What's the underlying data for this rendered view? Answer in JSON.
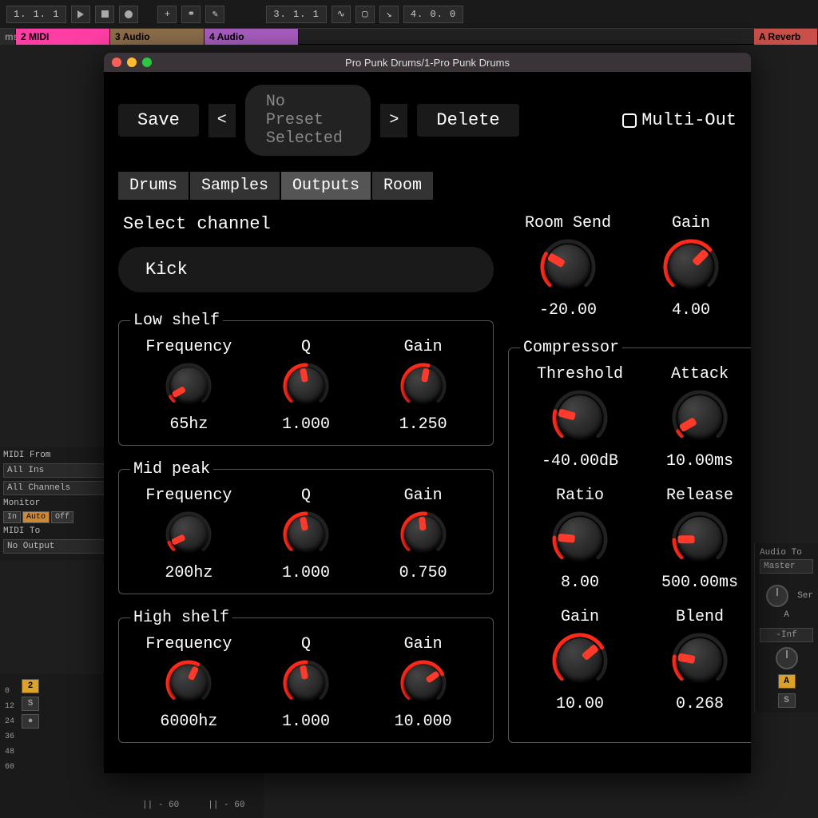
{
  "transport": {
    "pos1": "1. 1. 1",
    "pos2": "3. 1. 1",
    "pos3": "4. 0. 0"
  },
  "tracks": {
    "left": "ms",
    "midi": "2 MIDI",
    "audio1": "3 Audio",
    "audio2": "4 Audio",
    "reverb": "A Reverb"
  },
  "leftpanel": {
    "midi_from": "MIDI From",
    "all_ins": "All Ins",
    "all_channels": "All Channels",
    "monitor": "Monitor",
    "in": "In",
    "auto": "Auto",
    "off": "Off",
    "midi_to": "MIDI To",
    "no_output": "No Output"
  },
  "rightpanel": {
    "audio_to": "Audio To",
    "master": "Master",
    "sends_label": "Ser",
    "a": "A",
    "inf": "-Inf"
  },
  "mixer": {
    "scale": [
      "0",
      "12",
      "24",
      "36",
      "48",
      "60"
    ],
    "two": "2",
    "s": "S",
    "pan1": "|| - 60",
    "pan2": "|| - 60"
  },
  "plugin": {
    "window_title": "Pro Punk Drums/1-Pro Punk Drums",
    "save": "Save",
    "prev": "<",
    "preset": "No Preset Selected",
    "next": ">",
    "delete": "Delete",
    "multiout": "Multi-Out",
    "tabs": {
      "drums": "Drums",
      "samples": "Samples",
      "outputs": "Outputs",
      "room": "Room"
    },
    "select_channel": "Select channel",
    "channel": "Kick",
    "top": {
      "room_send": {
        "label": "Room Send",
        "value": "-20.00",
        "angle": -60,
        "arc": 0.28
      },
      "gain": {
        "label": "Gain",
        "value": "4.00",
        "angle": 45,
        "arc": 0.68
      }
    },
    "eq": {
      "low": {
        "legend": "Low shelf",
        "freq": {
          "label": "Frequency",
          "value": "65hz",
          "angle": -120,
          "arc": 0.05
        },
        "q": {
          "label": "Q",
          "value": "1.000",
          "angle": -10,
          "arc": 0.5
        },
        "gain": {
          "label": "Gain",
          "value": "1.250",
          "angle": 10,
          "arc": 0.55
        }
      },
      "mid": {
        "legend": "Mid peak",
        "freq": {
          "label": "Frequency",
          "value": "200hz",
          "angle": -115,
          "arc": 0.08
        },
        "q": {
          "label": "Q",
          "value": "1.000",
          "angle": -10,
          "arc": 0.5
        },
        "gain": {
          "label": "Gain",
          "value": "0.750",
          "angle": -5,
          "arc": 0.52
        }
      },
      "high": {
        "legend": "High shelf",
        "freq": {
          "label": "Frequency",
          "value": "6000hz",
          "angle": 25,
          "arc": 0.6
        },
        "q": {
          "label": "Q",
          "value": "1.000",
          "angle": -10,
          "arc": 0.5
        },
        "gain": {
          "label": "Gain",
          "value": "10.000",
          "angle": 55,
          "arc": 0.74
        }
      }
    },
    "comp": {
      "legend": "Compressor",
      "threshold": {
        "label": "Threshold",
        "value": "-40.00dB",
        "angle": -75,
        "arc": 0.22
      },
      "attack": {
        "label": "Attack",
        "value": "10.00ms",
        "angle": -120,
        "arc": 0.05
      },
      "ratio": {
        "label": "Ratio",
        "value": "8.00",
        "angle": -85,
        "arc": 0.18
      },
      "release": {
        "label": "Release",
        "value": "500.00ms",
        "angle": -90,
        "arc": 0.16
      },
      "gain": {
        "label": "Gain",
        "value": "10.00",
        "angle": 50,
        "arc": 0.72
      },
      "blend": {
        "label": "Blend",
        "value": "0.268",
        "angle": -80,
        "arc": 0.2
      }
    }
  }
}
